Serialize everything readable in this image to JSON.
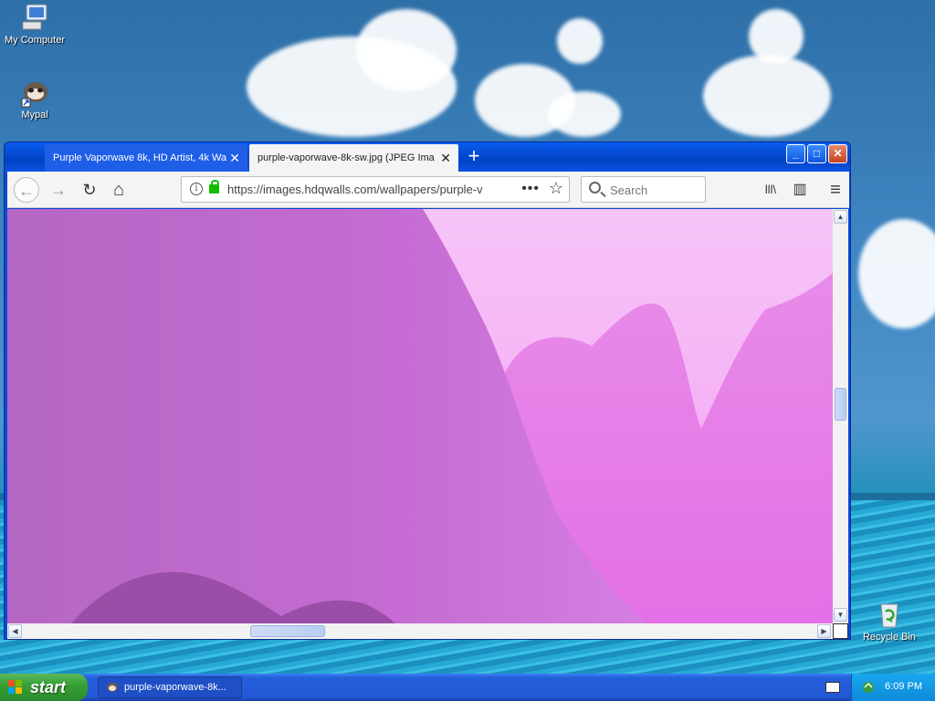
{
  "desktop": {
    "icons": [
      {
        "label": "My Computer",
        "icon": "my-computer-icon"
      },
      {
        "label": "Mypal",
        "icon": "mypal-browser-icon"
      },
      {
        "label": "Recycle Bin",
        "icon": "recycle-bin-icon"
      }
    ]
  },
  "browser": {
    "tabs": [
      {
        "title": "Purple Vaporwave 8k, HD Artist, 4k Wa",
        "close": "✕"
      },
      {
        "title": "purple-vaporwave-8k-sw.jpg (JPEG Ima",
        "close": "✕"
      }
    ],
    "new_tab": "+",
    "window_controls": {
      "minimize": "_",
      "maximize": "□",
      "close": "✕"
    },
    "nav": {
      "back": "←",
      "forward": "→",
      "reload": "↻",
      "home": "⌂"
    },
    "url": "https://images.hdqwalls.com/wallpapers/purple-v",
    "page_actions": "•••",
    "bookmark": "☆",
    "search_placeholder": "Search",
    "tools": {
      "library": "lll\\",
      "sidebar": "▥",
      "menu": "≡"
    }
  },
  "taskbar": {
    "start_label": "start",
    "items": [
      {
        "label": "purple-vaporwave-8k..."
      }
    ],
    "clock": "6:09 PM"
  },
  "colors": {
    "image_base": "#d774e4",
    "image_sky": "#f6b6f7",
    "image_mountain": "#a95cb5",
    "xp_blue": "#245edb",
    "start_green": "#36a136"
  }
}
